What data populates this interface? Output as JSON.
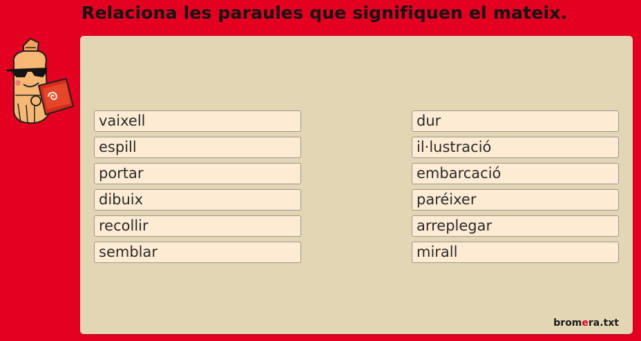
{
  "instruction": "Relaciona les paraules que signifiquen el mateix.",
  "left_words": [
    "vaixell",
    "espill",
    "portar",
    "dibuix",
    "recollir",
    "semblar"
  ],
  "right_words": [
    "dur",
    "il·lustració",
    "embarcació",
    "paréixer",
    "arreplegar",
    "mirall"
  ],
  "brand": {
    "part1": "brom",
    "part2": "e",
    "part3": "ra.txt"
  },
  "colors": {
    "background": "#e30020",
    "panel": "#e3d6b4",
    "word_box": "#fdebd3"
  },
  "mascot_icon": "pencil-mascot-reading-book-icon"
}
